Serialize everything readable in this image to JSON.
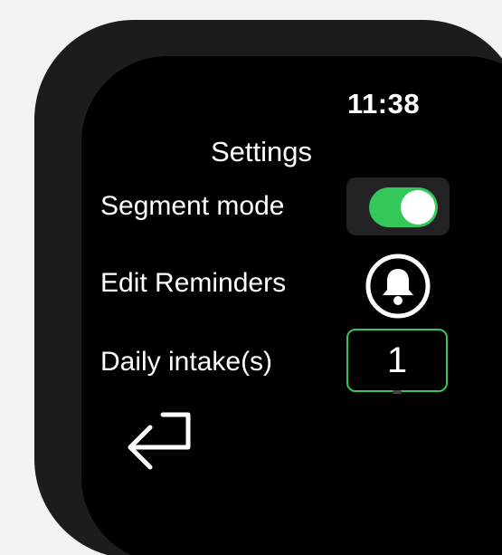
{
  "status_bar": {
    "time": "11:38"
  },
  "screen": {
    "title": "Settings",
    "rows": [
      {
        "label": "Segment mode",
        "control": "toggle",
        "value": true
      },
      {
        "label": "Edit Reminders",
        "control": "bell-icon"
      },
      {
        "label": "Daily intake(s)",
        "control": "stepper",
        "value": "1"
      }
    ],
    "back_icon": "return-arrow-icon"
  },
  "colors": {
    "accent": "#34c759",
    "screen_background": "#000000",
    "case": "#1c1c1e",
    "page_background": "#f2f2f2",
    "text": "#ffffff"
  }
}
